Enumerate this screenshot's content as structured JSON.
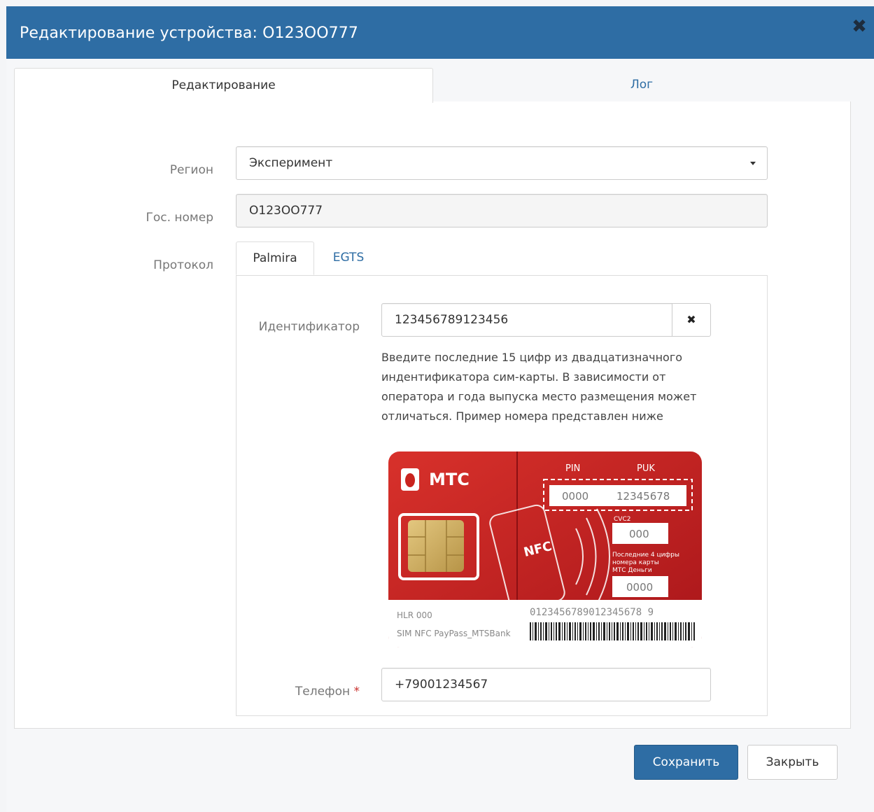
{
  "modal": {
    "title": "Редактирование устройства: О123ОО777",
    "close_icon": "close-icon"
  },
  "tabs": {
    "edit": "Редактирование",
    "log": "Лог"
  },
  "form": {
    "region_label": "Регион",
    "region_value": "Эксперимент",
    "plate_label": "Гос. номер",
    "plate_value": "О123ОО777",
    "protocol_label": "Протокол",
    "protocol_tabs": [
      "Palmira",
      "EGTS"
    ],
    "identifier_label": "Идентификатор",
    "identifier_value": "123456789123456",
    "identifier_help": "Введите последние 15 цифр из двадцатизначного индентификатора сим-карты. В зависимости от оператора и года выпуска место размещения может отличаться. Пример номера представлен ниже",
    "phone_label": "Телефон",
    "phone_required": "*",
    "phone_value": "+79001234567"
  },
  "simcard": {
    "brand": "МТС",
    "pin_label": "PIN",
    "puk_label": "PUK",
    "pin_value": "0000",
    "puk_value": "12345678",
    "cvc_label": "CVC2",
    "cvc_value": "000",
    "last4_text": "Последние 4 цифры номера карты МТС Деньги",
    "last4_value": "0000",
    "nfc": "NFC",
    "hlr": "HLR 000",
    "sim_text": "SIM NFC PayPass_MTSBank",
    "iccid": "0123456789012345678 9"
  },
  "buttons": {
    "save": "Сохранить",
    "close": "Закрыть"
  },
  "colors": {
    "header": "#2e6da4",
    "primary": "#2e6da4",
    "link": "#2e6da4",
    "sim_red": "#c9241f"
  }
}
